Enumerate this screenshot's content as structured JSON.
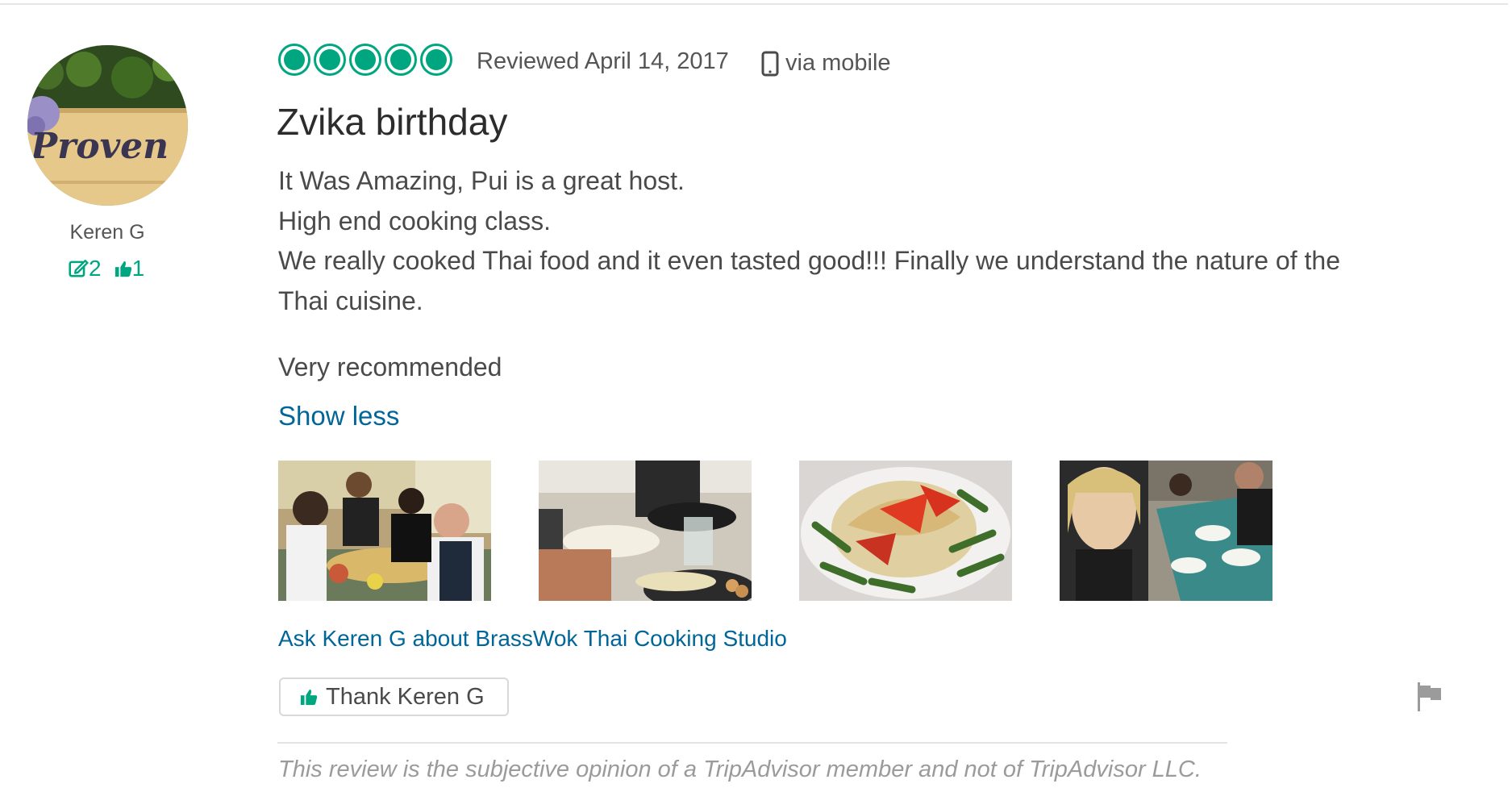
{
  "member": {
    "username": "Keren G",
    "reviews_count": "2",
    "helpful_votes": "1",
    "avatar_text": "Proven"
  },
  "review": {
    "rating_bubbles": 5,
    "date_label": "Reviewed April 14, 2017",
    "via_label": "via mobile",
    "title": "Zvika birthday",
    "paragraphs": [
      "It Was Amazing, Pui is a great host.",
      "High end cooking class.",
      "We really cooked Thai food and it even tasted good!!! Finally we understand the nature of the Thai cuisine."
    ],
    "closing": "Very recommended",
    "show_less": "Show less",
    "photos": [
      "cooking-class-group-photo",
      "wok-cooking-photo",
      "papaya-salad-photo",
      "dining-table-photo"
    ]
  },
  "actions": {
    "ask_link": "Ask Keren G about BrassWok Thai Cooking Studio",
    "thank_button": "Thank Keren G"
  },
  "disclaimer": "This review is the subjective opinion of a TripAdvisor member and not of TripAdvisor LLC.",
  "colors": {
    "accent_green": "#00a680",
    "link_blue": "#006699",
    "text_gray": "#4a4a4a"
  },
  "icons": [
    "edit-icon",
    "thumbs-up-icon",
    "mobile-icon",
    "flag-icon"
  ]
}
